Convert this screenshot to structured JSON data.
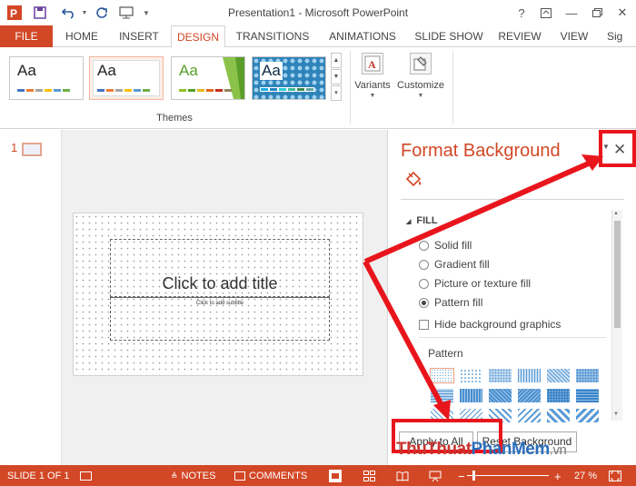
{
  "titlebar": {
    "title": "Presentation1 - Microsoft PowerPoint",
    "help": "?",
    "minimize": "—",
    "close": "✕"
  },
  "tabs": [
    {
      "label": "FILE"
    },
    {
      "label": "HOME"
    },
    {
      "label": "INSERT"
    },
    {
      "label": "DESIGN"
    },
    {
      "label": "TRANSITIONS"
    },
    {
      "label": "ANIMATIONS"
    },
    {
      "label": "SLIDE SHOW"
    },
    {
      "label": "REVIEW"
    },
    {
      "label": "VIEW"
    },
    {
      "label": "Sig"
    }
  ],
  "ribbon": {
    "theme_sample": "Aa",
    "themes_label": "Themes",
    "variants_label": "Variants",
    "customize_label": "Customize"
  },
  "thumbnail": {
    "number": "1"
  },
  "slide": {
    "title_placeholder": "Click to add title",
    "subtitle_placeholder": "Click to add subtitle"
  },
  "pane": {
    "title": "Format Background",
    "close": "✕",
    "fill_header": "FILL",
    "options": [
      {
        "label": "Solid fill",
        "selected": false
      },
      {
        "label": "Gradient fill",
        "selected": false
      },
      {
        "label": "Picture or texture fill",
        "selected": false
      },
      {
        "label": "Pattern fill",
        "selected": true
      }
    ],
    "hide_graphics": "Hide background graphics",
    "pattern_label": "Pattern",
    "apply_all": "Apply to All",
    "reset": "Reset Background"
  },
  "status": {
    "slide": "SLIDE 1 OF 1",
    "notes": "NOTES",
    "comments": "COMMENTS",
    "zoom_minus": "−",
    "zoom_plus": "+",
    "zoom": "27 %"
  },
  "watermark": {
    "part1": "ThuThuat",
    "part2": "PhanMem",
    "part3": ".vn"
  },
  "colors": {
    "accent": "#d24726",
    "annotation": "#e8161c"
  }
}
